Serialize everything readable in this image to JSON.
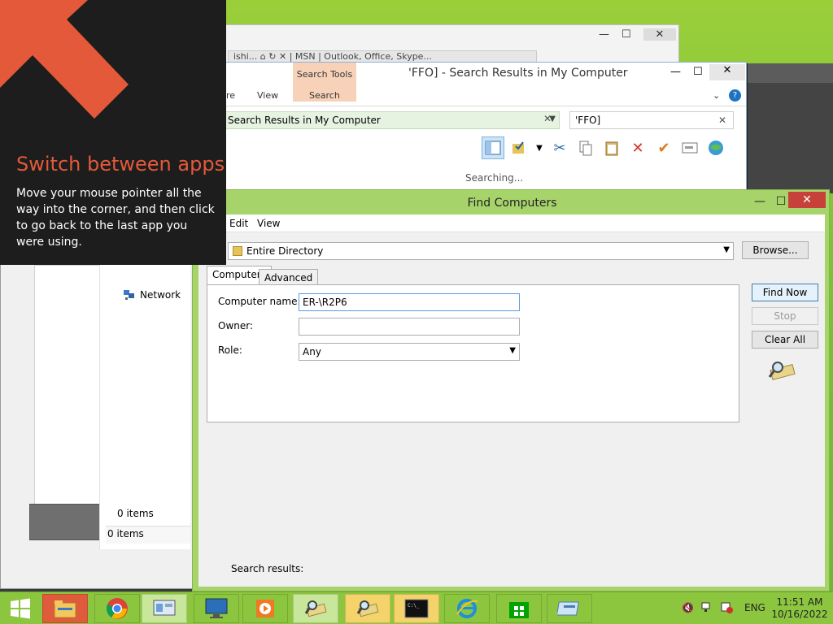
{
  "hint": {
    "title": "Switch between apps",
    "body": "Move your mouse pointer all the way into the corner, and then click to go back to the last app you were using."
  },
  "search_window": {
    "title": "'FFO] - Search Results in My Computer",
    "search_tools_tab": "Search Tools",
    "ribbon_tabs": [
      "re",
      "View",
      "Search"
    ],
    "address": "Search Results in My Computer",
    "search_box": "'FFO]",
    "status": "Searching..."
  },
  "browser_window": {
    "tab_text": "ishi... ⌂ ↻ ✕ | MSN | Outlook, Office, Skype..."
  },
  "explorer_background": {
    "nav_network": "Network",
    "items_nav": "0 items",
    "items_status": "0 items"
  },
  "find_computers": {
    "title": "Find Computers",
    "menu": [
      "Edit",
      "View"
    ],
    "scope": "Entire Directory",
    "browse_button": "Browse...",
    "tabs": [
      "Computers",
      "Advanced"
    ],
    "computer_name_label": "Computer name:",
    "computer_name_value": "ER-\\R2P6",
    "owner_label": "Owner:",
    "owner_value": "",
    "role_label": "Role:",
    "role_value": "Any",
    "find_now_button": "Find Now",
    "stop_button": "Stop",
    "clear_all_button": "Clear All",
    "search_results_label": "Search results:"
  },
  "taskbar": {
    "items": [
      "start",
      "file-explorer",
      "chrome",
      "control-panel",
      "remote-desktop",
      "media-player",
      "find-computers",
      "find-computers-2",
      "command-prompt",
      "internet-explorer",
      "store",
      "server-manager"
    ],
    "language": "ENG",
    "time": "11:51 AM",
    "date": "10/16/2022"
  },
  "colors": {
    "accent_green": "#8cc63f",
    "hint_orange": "#e4593a",
    "close_red": "#c7413a"
  }
}
